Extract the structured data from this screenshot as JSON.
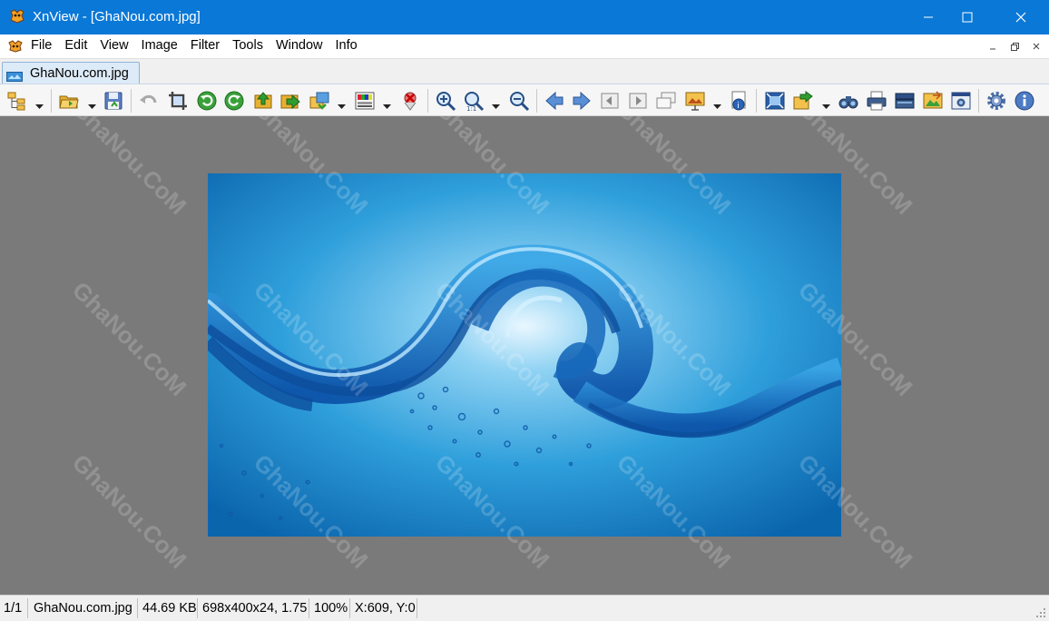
{
  "window": {
    "title": "XnView - [GhaNou.com.jpg]",
    "titlebar_color": "#0a78d7"
  },
  "menu": {
    "items": [
      "File",
      "Edit",
      "View",
      "Image",
      "Filter",
      "Tools",
      "Window",
      "Info"
    ]
  },
  "tabs": [
    {
      "label": "GhaNou.com.jpg",
      "active": true
    }
  ],
  "toolbar": {
    "buttons": [
      "browser-icon",
      "open-folder-icon",
      "save-icon",
      "undo-icon",
      "crop-icon",
      "rotate-left-icon",
      "rotate-right-icon",
      "move-up-icon",
      "move-right-icon",
      "convert-icon",
      "color-adjust-icon",
      "delete-icon",
      "zoom-in-icon",
      "zoom-icon",
      "zoom-out-icon",
      "previous-icon",
      "next-icon",
      "first-page-icon",
      "next-page-icon",
      "multipage-icon",
      "slideshow-icon",
      "properties-icon",
      "fullscreen-icon",
      "export-icon",
      "find-icon",
      "print-icon",
      "scanner-icon",
      "compare-icon",
      "capture-icon",
      "settings-icon",
      "info-icon"
    ]
  },
  "viewer": {
    "background": "#7a7a7a",
    "image_name": "GhaNou.com.jpg",
    "watermark": "GhaNou.CoM"
  },
  "status": {
    "page": "1/1",
    "filename": "GhaNou.com.jpg",
    "filesize": "44.69 KB",
    "dimensions": "698x400x24, 1.75",
    "zoom": "100%",
    "coords": "X:609, Y:0"
  }
}
